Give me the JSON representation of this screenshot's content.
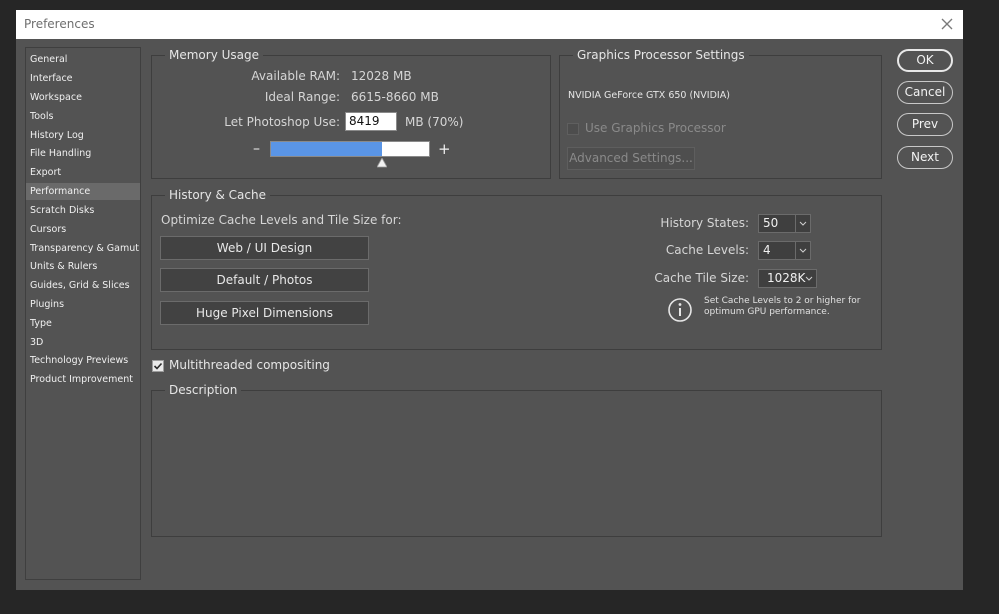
{
  "window": {
    "title": "Preferences"
  },
  "sidebar": {
    "items": [
      {
        "label": "General"
      },
      {
        "label": "Interface"
      },
      {
        "label": "Workspace"
      },
      {
        "label": "Tools"
      },
      {
        "label": "History Log"
      },
      {
        "label": "File Handling"
      },
      {
        "label": "Export"
      },
      {
        "label": "Performance",
        "active": true
      },
      {
        "label": "Scratch Disks"
      },
      {
        "label": "Cursors"
      },
      {
        "label": "Transparency & Gamut"
      },
      {
        "label": "Units & Rulers"
      },
      {
        "label": "Guides, Grid & Slices"
      },
      {
        "label": "Plugins"
      },
      {
        "label": "Type"
      },
      {
        "label": "3D"
      },
      {
        "label": "Technology Previews"
      },
      {
        "label": "Product Improvement"
      }
    ]
  },
  "memory": {
    "title": "Memory Usage",
    "available_label": "Available RAM:",
    "available_value": "12028 MB",
    "ideal_label": "Ideal Range:",
    "ideal_value": "6615-8660 MB",
    "use_label": "Let Photoshop Use:",
    "use_value": "8419",
    "use_suffix": "MB (70%)",
    "slider_percent": 70,
    "minus": "–",
    "plus": "+"
  },
  "gpu": {
    "title": "Graphics Processor Settings",
    "card": "NVIDIA GeForce GTX 650 (NVIDIA)",
    "use_gpu_label": "Use Graphics Processor",
    "use_gpu_checked": false,
    "advanced_label": "Advanced Settings..."
  },
  "history_cache": {
    "title": "History & Cache",
    "optimize_label": "Optimize Cache Levels and Tile Size for:",
    "presets": [
      "Web / UI Design",
      "Default / Photos",
      "Huge Pixel Dimensions"
    ],
    "history_states_label": "History States:",
    "history_states_value": "50",
    "cache_levels_label": "Cache Levels:",
    "cache_levels_value": "4",
    "tile_size_label": "Cache Tile Size:",
    "tile_size_value": "1028K",
    "info_text_1": "Set Cache Levels to 2 or higher for",
    "info_text_2": "optimum GPU performance."
  },
  "multithreaded": {
    "label": "Multithreaded compositing",
    "checked": true
  },
  "description": {
    "title": "Description"
  },
  "buttons": {
    "ok": "OK",
    "cancel": "Cancel",
    "prev": "Prev",
    "next": "Next"
  },
  "colors": {
    "slider_fill": "#5a95e6",
    "panel_bg": "#535353",
    "accent_border": "#e8e8e8"
  }
}
